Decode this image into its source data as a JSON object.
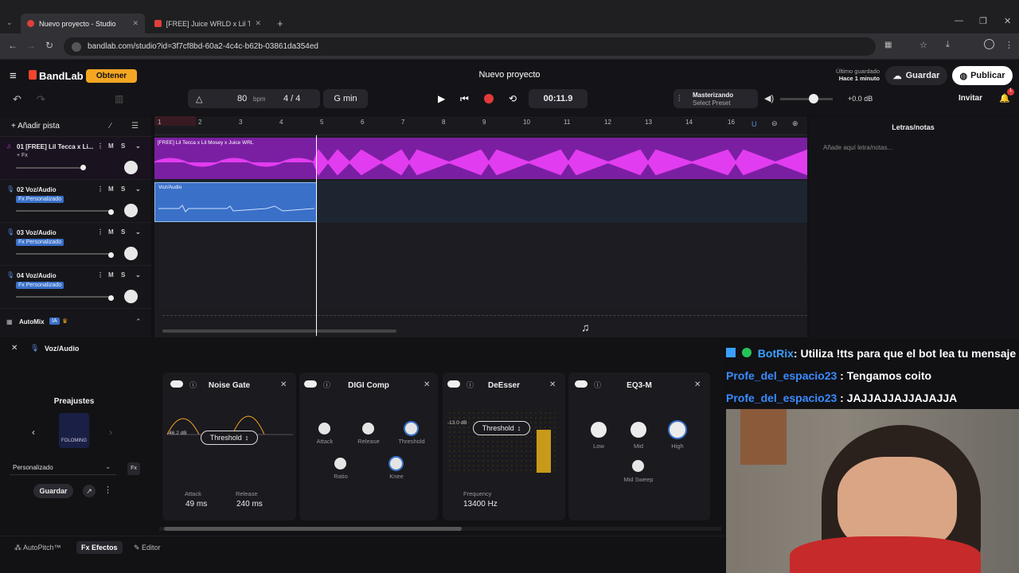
{
  "browser": {
    "tabs": [
      {
        "title": "Nuevo proyecto - Studio"
      },
      {
        "title": "[FREE] Juice WRLD x Lil Tecca Ty"
      }
    ],
    "url": "bandlab.com/studio?id=3f7cf8bd-60a2-4c4c-b62b-03861da354ed"
  },
  "app": {
    "brand": "BandLab",
    "get_button": "Obtener",
    "project_title": "Nuevo proyecto",
    "last_saved_label": "Último guardado",
    "last_saved_time": "Hace 1 minuto",
    "save": "Guardar",
    "publish": "Publicar",
    "invite": "Invitar",
    "notif_count": "1"
  },
  "transport": {
    "bpm": "80",
    "bpm_unit": "bpm",
    "time_sig": "4 / 4",
    "key": "G min",
    "time": "00:11.9",
    "mastering_title": "Masterizando",
    "mastering_preset": "Select Preset",
    "volume_db": "+0.0 dB"
  },
  "tracks": {
    "add": "Añadir pista",
    "automix": "AutoMix",
    "automix_badge": "IA",
    "items": [
      {
        "num": "01",
        "name": "[FREE] Lil Tecca x Li...",
        "fx": "+ Fx"
      },
      {
        "num": "02",
        "name": "Voz/Audio",
        "fx": "Fx Personalizado"
      },
      {
        "num": "03",
        "name": "Voz/Audio",
        "fx": "Fx Personalizado"
      },
      {
        "num": "04",
        "name": "Voz/Audio",
        "fx": "Fx Personalizado"
      }
    ]
  },
  "timeline": {
    "bars": [
      "1",
      "2",
      "3",
      "4",
      "5",
      "6",
      "7",
      "8",
      "9",
      "10",
      "11",
      "12",
      "13",
      "14",
      "16"
    ],
    "clip1": "[FREE] Lil Tecca x Lil Mosey x Juice WRL",
    "clip2": "Voz/Audio"
  },
  "lyrics": {
    "title": "Letras/notas",
    "placeholder": "Añade aquí letra/notas..."
  },
  "fx": {
    "track": "Voz/Audio",
    "presets_title": "Preajustes",
    "preset_name": "FOLOMING",
    "preset_select": "Personalizado",
    "save": "Guardar",
    "modes": [
      "AutoPitch™",
      "Efectos",
      "Editor"
    ],
    "gate": {
      "title": "Noise Gate",
      "level": "-46.2 dB",
      "mode": "Threshold",
      "attack_label": "Attack",
      "attack": "49 ms",
      "release_label": "Release",
      "release": "240 ms"
    },
    "comp": {
      "title": "DIGI Comp",
      "knobs": [
        "Attack",
        "Release",
        "Threshold",
        "Ratio",
        "Knee"
      ]
    },
    "deesser": {
      "title": "DeEsser",
      "level": "-13.0 dB",
      "mode": "Threshold",
      "freq_label": "Frequency",
      "freq": "13400 Hz"
    },
    "eq": {
      "title": "EQ3-M",
      "knobs": [
        "Low",
        "Mid",
        "High",
        "Mid Sweep"
      ]
    }
  },
  "chat": [
    {
      "user": "BotRix",
      "msg": ": Utiliza !tts para que el bot lea tu mensaje",
      "color": "#3aa0ff"
    },
    {
      "user": "Profe_del_espacio23",
      "msg": " : Tengamos coito",
      "color": "#3a8bff"
    },
    {
      "user": "Profe_del_espacio23",
      "msg": " : JAJJAJJAJJAJAJJA",
      "color": "#3a8bff"
    }
  ]
}
